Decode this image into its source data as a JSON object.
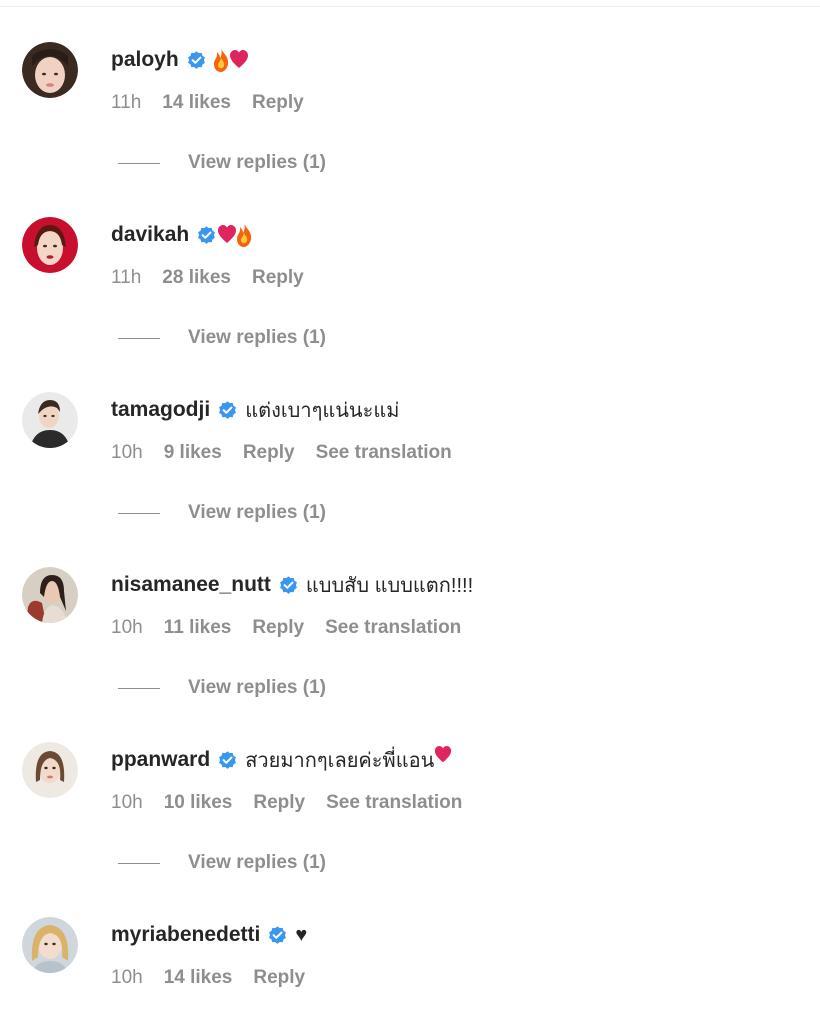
{
  "comments": [
    {
      "username": "paloyh",
      "text": "",
      "emoji": [
        "fire",
        "heart"
      ],
      "time": "11h",
      "likes": "14 likes",
      "reply": "Reply",
      "translation": "",
      "view_replies": "View replies (1)"
    },
    {
      "username": "davikah",
      "text": "",
      "emoji": [
        "heart",
        "fire"
      ],
      "time": "11h",
      "likes": "28 likes",
      "reply": "Reply",
      "translation": "",
      "view_replies": "View replies (1)"
    },
    {
      "username": "tamagodji",
      "text": "แต่งเบาๆแน่นะแม่",
      "emoji": [],
      "time": "10h",
      "likes": "9 likes",
      "reply": "Reply",
      "translation": "See translation",
      "view_replies": "View replies (1)"
    },
    {
      "username": "nisamanee_nutt",
      "text": "แบบสับ แบบแตก!!!!",
      "emoji": [],
      "time": "10h",
      "likes": "11 likes",
      "reply": "Reply",
      "translation": "See translation",
      "view_replies": "View replies (1)"
    },
    {
      "username": "ppanward",
      "text": "สวยมากๆเลยค่ะพี่แอน",
      "emoji": [
        "heart"
      ],
      "time": "10h",
      "likes": "10 likes",
      "reply": "Reply",
      "translation": "See translation",
      "view_replies": "View replies (1)"
    },
    {
      "username": "myriabenedetti",
      "text": "♥",
      "emoji": [],
      "time": "10h",
      "likes": "14 likes",
      "reply": "Reply",
      "translation": "",
      "view_replies": ""
    }
  ],
  "colors": {
    "verified": "#3897f0",
    "secondary_text": "#8e8e8e",
    "primary_text": "#262626",
    "heart": "#e0245e",
    "fire": "#f7630c"
  }
}
